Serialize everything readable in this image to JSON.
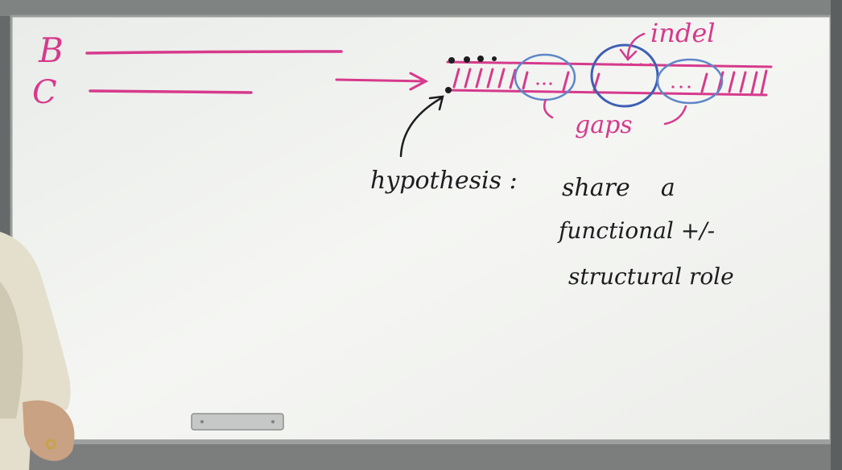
{
  "board": {
    "labels": {
      "b": "B",
      "c": "C",
      "indel": "indel",
      "gaps": "gaps",
      "hypothesis": "hypothesis :",
      "line1": "share    a",
      "line2": "functional +/-",
      "line3": "structural role"
    }
  },
  "colors": {
    "board": "#f2f4f1",
    "frame": "#6e7270",
    "marker_magenta": "#d63a8c",
    "marker_blue": "#5f86c8",
    "marker_dark_blue": "#3e5fb5",
    "marker_black": "#1d1d1f",
    "skin": "#c9a183",
    "shirt": "#e4dfcc"
  },
  "icons": [
    "arrow-icon",
    "circle-annotation-icon"
  ]
}
